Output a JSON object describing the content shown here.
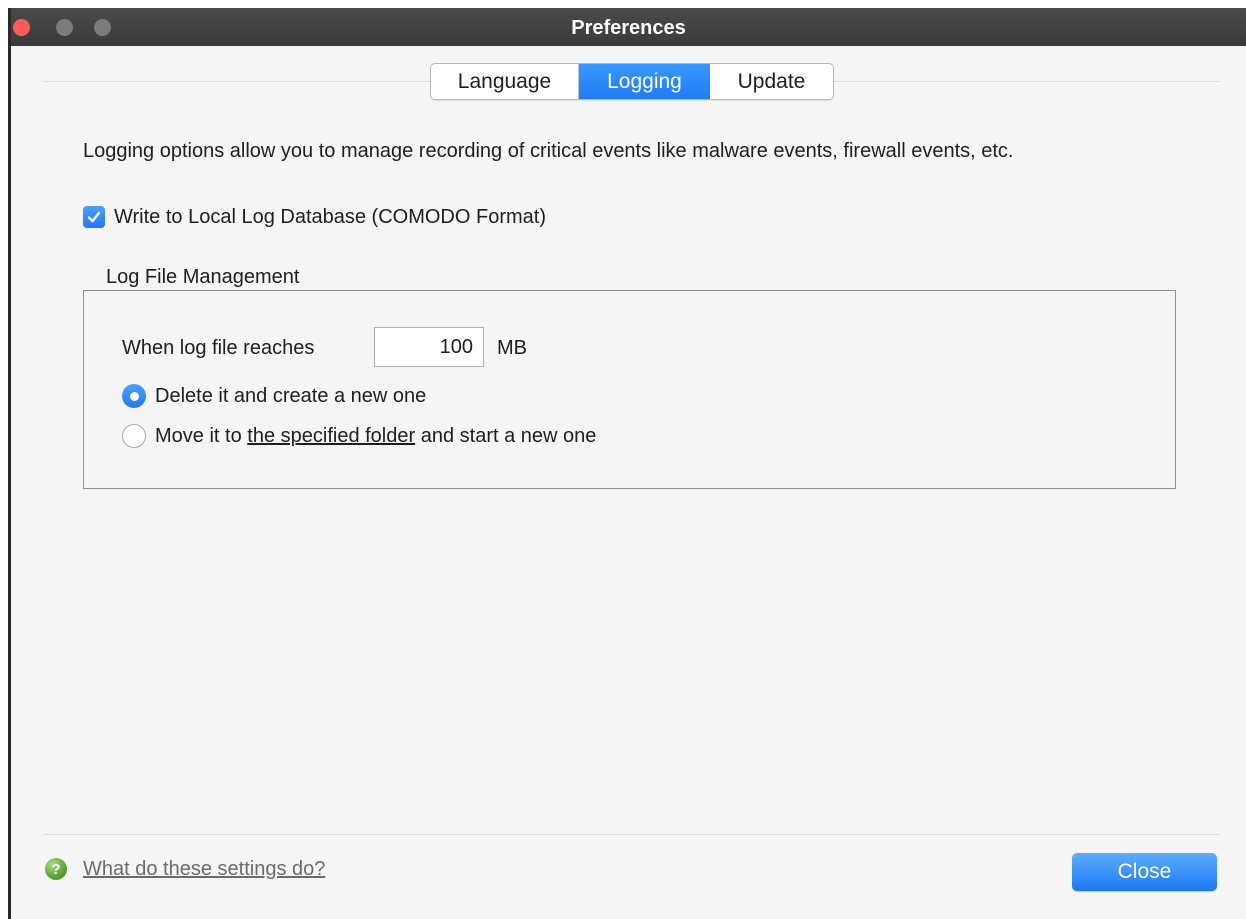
{
  "window": {
    "title": "Preferences"
  },
  "tabs": [
    {
      "label": "Language",
      "selected": false
    },
    {
      "label": "Logging",
      "selected": true
    },
    {
      "label": "Update",
      "selected": false
    }
  ],
  "logging": {
    "description": "Logging options allow you to manage recording of critical events like malware events, firewall events, etc.",
    "write_local_db": {
      "label": "Write to Local Log Database (COMODO Format)",
      "checked": true
    },
    "group_title": "Log File Management",
    "reach_label": "When log file reaches",
    "size_value": "100",
    "size_unit": "MB",
    "options": {
      "delete": {
        "label": "Delete it and create a new one",
        "selected": true
      },
      "move": {
        "prefix": "Move it to ",
        "link": "the specified folder",
        "suffix": " and start a new one",
        "selected": false
      }
    }
  },
  "footer": {
    "help_icon": "help-question-icon",
    "help_link": "What do these settings do?",
    "close_label": "Close"
  },
  "colors": {
    "accent": "#2a85f7",
    "close_traffic": "#fc5b57",
    "titlebar": "#404040"
  }
}
